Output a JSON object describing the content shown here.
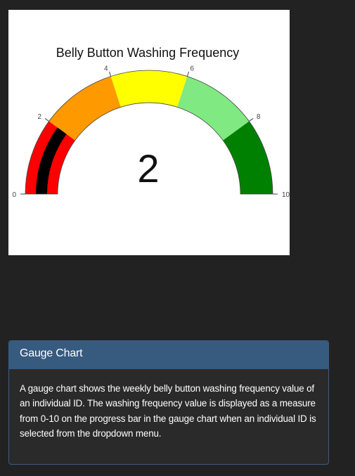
{
  "chart_data": {
    "type": "gauge",
    "title": "Belly Button Washing Frequency",
    "value": 2,
    "value_label": "2",
    "range": [
      0,
      10
    ],
    "ticks": [
      0,
      2,
      4,
      6,
      8,
      10
    ],
    "tick_labels": [
      "0",
      "2",
      "4",
      "6",
      "8",
      "10"
    ],
    "bands": [
      {
        "from": 0,
        "to": 2,
        "color": "#ff0000"
      },
      {
        "from": 2,
        "to": 4,
        "color": "#ff9900"
      },
      {
        "from": 4,
        "to": 6,
        "color": "#ffff00"
      },
      {
        "from": 6,
        "to": 8,
        "color": "#80e982"
      },
      {
        "from": 8,
        "to": 10,
        "color": "#008000"
      }
    ],
    "bar_color": "#000000"
  },
  "panel": {
    "heading": "Gauge Chart",
    "body": "A gauge chart shows the weekly belly button washing frequency value of an individual ID. The washing frequency value is displayed as a measure from 0-10 on the progress bar in the gauge chart when an individual ID is selected from the dropdown menu."
  },
  "colors": {
    "page_background": "#222222",
    "panel_heading": "#375a7f",
    "panel_body": "#2a2a2a"
  }
}
